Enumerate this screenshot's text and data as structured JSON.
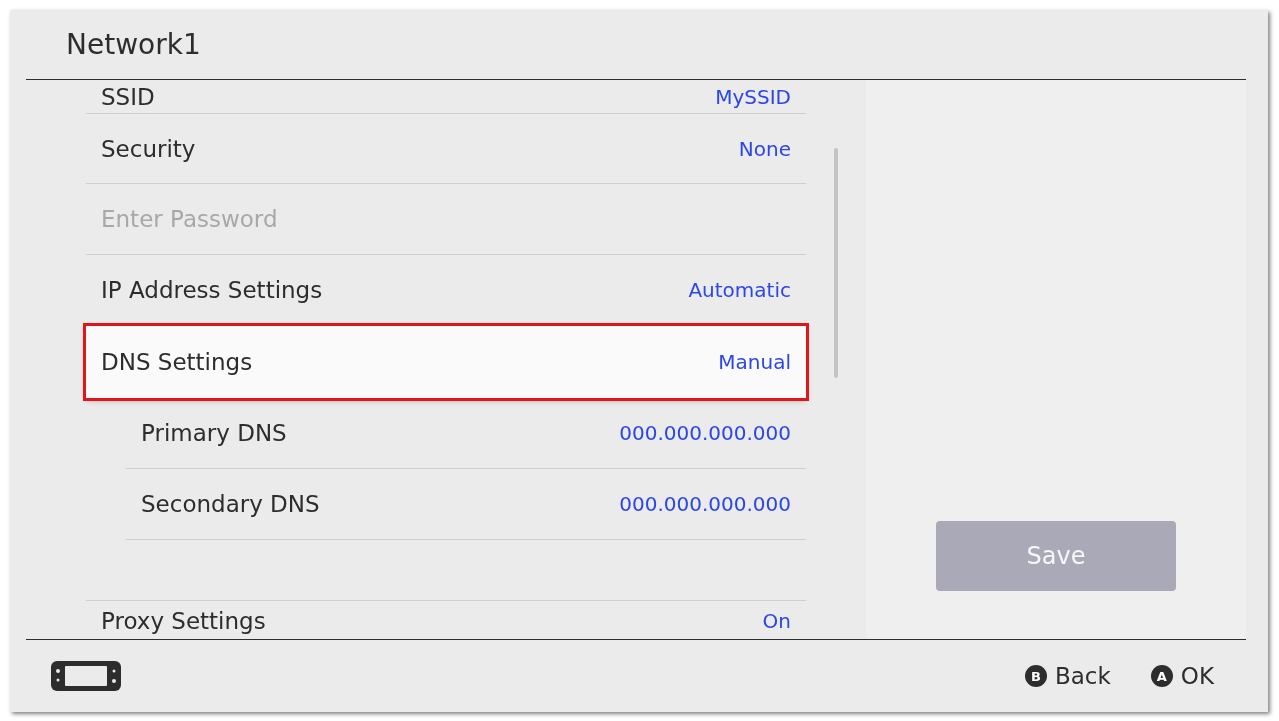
{
  "header": {
    "title": "Network1"
  },
  "settings": [
    {
      "label": "SSID",
      "value": "MySSID",
      "disabled": false,
      "selected": false
    },
    {
      "label": "Security",
      "value": "None",
      "disabled": false,
      "selected": false
    },
    {
      "label": "Enter Password",
      "disabled": true,
      "selected": false
    },
    {
      "label": "IP Address Settings",
      "value": "Automatic",
      "disabled": false,
      "selected": false
    },
    {
      "label": "DNS Settings",
      "value": "Manual",
      "disabled": false,
      "selected": true,
      "children": [
        {
          "label": "Primary DNS",
          "value": "000.000.000.000",
          "disabled": false,
          "selected": false
        },
        {
          "label": "Secondary DNS",
          "value": "000.000.000.000",
          "disabled": false,
          "selected": false
        }
      ]
    },
    {
      "label": "Proxy Settings",
      "value": "On",
      "disabled": false,
      "selected": false
    }
  ],
  "save_button": {
    "label": "Save",
    "disabled": true
  },
  "footer": {
    "controls": [
      {
        "key": "B",
        "label": "Back"
      },
      {
        "key": "A",
        "label": "OK"
      }
    ]
  }
}
